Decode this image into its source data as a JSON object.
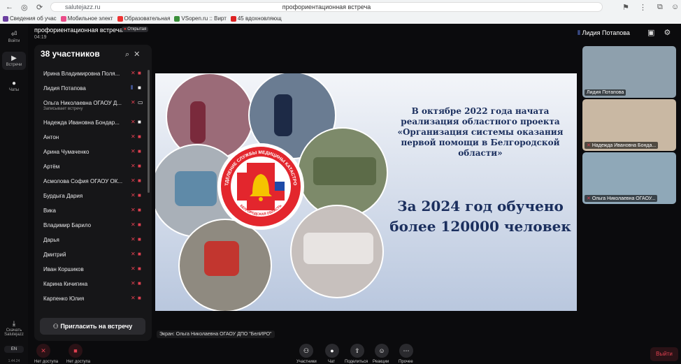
{
  "browser": {
    "url": "salutejazz.ru",
    "title": "профориентационная встреча",
    "bookmarks": [
      "Сведения об учас",
      "Мобильное элект",
      "Образовательная",
      "VSopen.ru :: Вирт",
      "45 вдохновляющ"
    ]
  },
  "rail": {
    "items": [
      {
        "label": "Войти",
        "icon": "⏎"
      },
      {
        "label": "Встречи",
        "icon": "▶"
      },
      {
        "label": "Чаты",
        "icon": "●"
      }
    ],
    "download_line1": "Скачать",
    "download_line2": "Salutejazz",
    "version": "1.44.24",
    "lang": "EN"
  },
  "header": {
    "meeting_title": "профориентационная встреча",
    "recording_badge": "Открытая",
    "time": "04:19",
    "active_speaker": "Лидия Потапова"
  },
  "participants": {
    "title": "38 участников",
    "invite_label": "Пригласить на встречу",
    "list": [
      {
        "name": "Ирина Владимировна Поля...",
        "mic": "off",
        "cam": "off"
      },
      {
        "name": "Лидия Потапова",
        "mic": "on",
        "cam": "on"
      },
      {
        "name": "Ольга Николаевна ОГАОУ Д...",
        "sub": "Записывает встречу",
        "mic": "off",
        "cam": "screen"
      },
      {
        "name": "Надежда Ивановна Бондар...",
        "mic": "off",
        "cam": "on"
      },
      {
        "name": "Антон",
        "mic": "off",
        "cam": "off"
      },
      {
        "name": "Арина Чумаченко",
        "mic": "off",
        "cam": "off"
      },
      {
        "name": "Артём",
        "mic": "off",
        "cam": "off"
      },
      {
        "name": "Асмолова София ОГАОУ ОК...",
        "mic": "off",
        "cam": "off"
      },
      {
        "name": "Бурдыга Дария",
        "mic": "off",
        "cam": "off"
      },
      {
        "name": "Вика",
        "mic": "off",
        "cam": "off"
      },
      {
        "name": "Владимир Барило",
        "mic": "off",
        "cam": "off"
      },
      {
        "name": "Дарья",
        "mic": "off",
        "cam": "off"
      },
      {
        "name": "Дмитрий",
        "mic": "off",
        "cam": "off"
      },
      {
        "name": "Иван Коршиков",
        "mic": "off",
        "cam": "off"
      },
      {
        "name": "Карина Кичигина",
        "mic": "off",
        "cam": "off"
      },
      {
        "name": "Карпенко Юлия",
        "mic": "off",
        "cam": "off"
      }
    ]
  },
  "slide": {
    "heading": "В октябре 2022 года начата реализация областного проекта «Организация системы оказания первой помощи в Белгородской области»",
    "stat": "За 2024 год обучено более 120000 человек",
    "emblem_top": "ОТДЕЛЕНИЕ СЛУЖБЫ МЕДИЦИНЫ КАТАСТРОФ",
    "emblem_bottom": "БЕЛГОРОДСКАЯ ОБЛАСТЬ",
    "screen_label": "Экран: Ольга Николаевна ОГАОУ ДПО \"БелИРО\""
  },
  "tiles": [
    {
      "name": "Лидия Потапова",
      "muted": false,
      "bg": "#9fb3c2"
    },
    {
      "name": "Надежда Ивановна Бонда...",
      "muted": true,
      "bg": "#c9b8a3"
    },
    {
      "name": "Ольга Николаевна ОГАОУ...",
      "muted": true,
      "bg": "#8fa8b8"
    }
  ],
  "toolbar": {
    "mic_label": "Нет доступа",
    "cam_label": "Нет доступа",
    "participants_label": "Участники",
    "chat_label": "Чат",
    "share_label": "Поделиться",
    "reactions_label": "Реакции",
    "more_label": "Прочее",
    "exit_label": "Выйти"
  },
  "colors": {
    "accent": "#6a8cff",
    "danger": "#e04050",
    "slide_text": "#1b2f5e",
    "emblem_red": "#e3262d"
  }
}
